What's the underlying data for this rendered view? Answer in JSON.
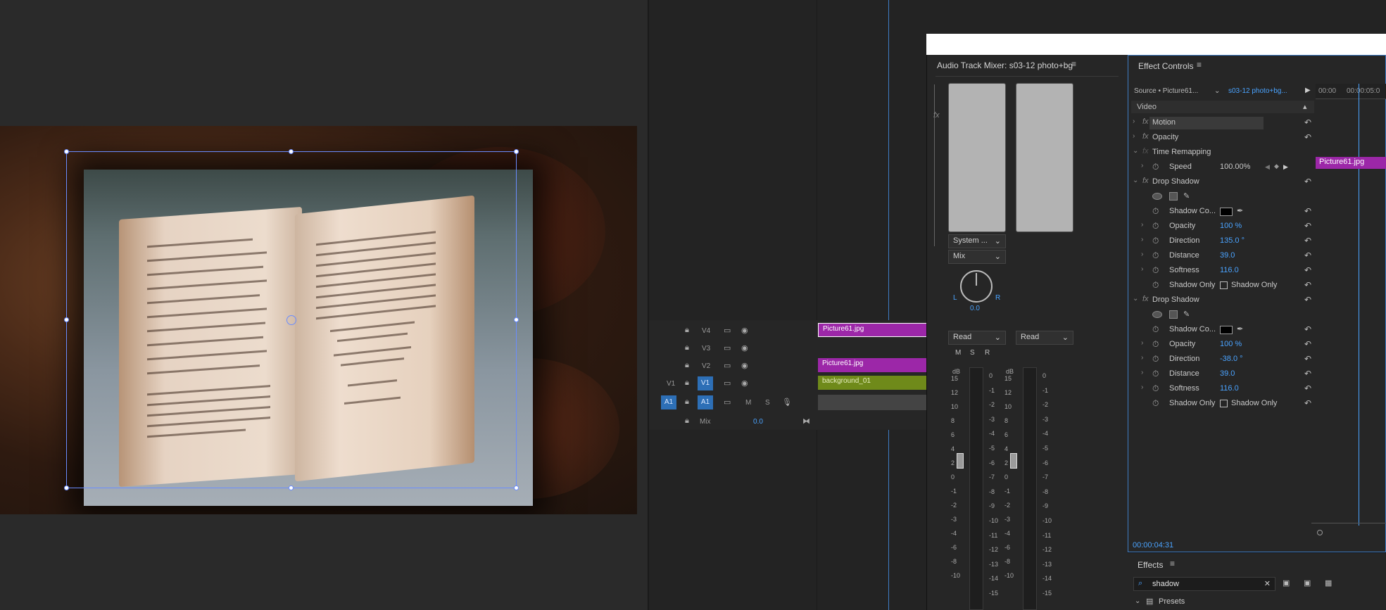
{
  "timeline": {
    "tracks": [
      {
        "source": "",
        "name": "V4"
      },
      {
        "source": "",
        "name": "V3"
      },
      {
        "source": "",
        "name": "V2"
      },
      {
        "source": "V1",
        "name": "V1"
      },
      {
        "source": "A1",
        "name": "A1"
      }
    ],
    "audio_buttons": {
      "mute": "M",
      "solo": "S"
    },
    "mix_label": "Mix",
    "mix_value": "0.0",
    "clips": [
      "Picture61.jpg",
      "Picture61.jpg",
      "background_01"
    ]
  },
  "mixer": {
    "title": "Audio Track Mixer: s03-12 photo+bg",
    "output": "System ...",
    "mode": "Mix",
    "pan_value": "0.0",
    "pan_left": "L",
    "pan_right": "R",
    "automation": [
      "Read",
      "Read"
    ],
    "msr": [
      "M",
      "S",
      "R"
    ],
    "db_label": "dB",
    "scale_left": [
      "15",
      "12",
      "10",
      "8",
      "6",
      "4",
      "2",
      "0",
      "-1",
      "-2",
      "-3",
      "-4",
      "-6",
      "-8",
      "-10"
    ],
    "scale_right": [
      "0",
      "-1",
      "-2",
      "-3",
      "-4",
      "-5",
      "-6",
      "-7",
      "-8",
      "-9",
      "-10",
      "-11",
      "-12",
      "-13",
      "-14",
      "-15"
    ]
  },
  "effect_controls": {
    "title": "Effect Controls",
    "source": "Source • Picture61...",
    "sequence": "s03-12 photo+bg...",
    "ruler": [
      "00:00",
      "00:00:05:0"
    ],
    "clip_bar": "Picture61.jpg",
    "section": "Video",
    "rows": [
      {
        "name": "Motion",
        "value": ""
      },
      {
        "name": "Opacity",
        "value": ""
      },
      {
        "name": "Time Remapping",
        "value": ""
      },
      {
        "name": "Speed",
        "value": "100.00%"
      },
      {
        "name": "Drop Shadow",
        "value": ""
      },
      {
        "name": "",
        "value": ""
      },
      {
        "name": "Shadow Co...",
        "value": ""
      },
      {
        "name": "Opacity",
        "value": "100 %"
      },
      {
        "name": "Direction",
        "value": "135.0 °"
      },
      {
        "name": "Distance",
        "value": "39.0"
      },
      {
        "name": "Softness",
        "value": "116.0"
      },
      {
        "name": "Shadow Only",
        "value": "Shadow Only"
      },
      {
        "name": "Drop Shadow",
        "value": ""
      },
      {
        "name": "",
        "value": ""
      },
      {
        "name": "Shadow Co...",
        "value": ""
      },
      {
        "name": "Opacity",
        "value": "100 %"
      },
      {
        "name": "Direction",
        "value": "-38.0 °"
      },
      {
        "name": "Distance",
        "value": "39.0"
      },
      {
        "name": "Softness",
        "value": "116.0"
      },
      {
        "name": "Shadow Only",
        "value": "Shadow Only"
      }
    ],
    "timecode": "00:00:04:31"
  },
  "effects": {
    "title": "Effects",
    "search_value": "shadow",
    "presets": "Presets"
  },
  "colors": {
    "accent": "#4aa3ff",
    "clip_purple": "#9c27a8",
    "clip_olive": "#6f8a1a",
    "selected_blue": "#2d6fb6"
  }
}
